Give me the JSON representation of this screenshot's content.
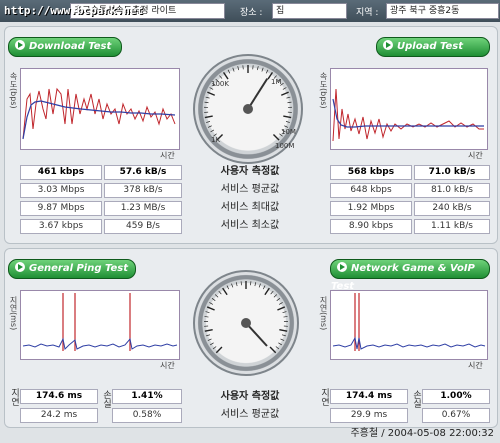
{
  "topbar": {
    "watermark": "http://www.bcpark.net",
    "program_text": "초고속통신속도측정 라이트",
    "place_label": "장소 :",
    "place_value": "집",
    "region_label": "지역 :",
    "region_value": "광주 북구 중흥2동"
  },
  "download": {
    "button": "Download Test",
    "ylabel": "속도(bps)",
    "xlabel": "시간",
    "rows": [
      [
        "461 kbps",
        "57.6 kB/s"
      ],
      [
        "3.03 Mbps",
        "378 kB/s"
      ],
      [
        "9.87 Mbps",
        "1.23 MB/s"
      ],
      [
        "3.67 kbps",
        "459 B/s"
      ]
    ]
  },
  "upload": {
    "button": "Upload Test",
    "ylabel": "속도(bps)",
    "xlabel": "시간",
    "rows": [
      [
        "568 kbps",
        "71.0 kB/s"
      ],
      [
        "648 kbps",
        "81.0 kB/s"
      ],
      [
        "1.92 Mbps",
        "240 kB/s"
      ],
      [
        "8.90 kbps",
        "1.11 kB/s"
      ]
    ]
  },
  "speed_labels": [
    "사용자 측정값",
    "서비스 평균값",
    "서비스 최대값",
    "서비스 최소값"
  ],
  "speed_gauge": {
    "ticks": [
      "100K",
      "1M",
      "10M",
      "100M",
      "1K"
    ],
    "needle_fraction": 0.62
  },
  "ping": {
    "button": "General Ping Test",
    "ylabel": "지연(ms)",
    "xlabel": "시간",
    "side_latency": "지연",
    "side_loss": "손실",
    "rows": [
      [
        "174.6 ms",
        "1.41%"
      ],
      [
        "24.2 ms",
        "0.58%"
      ]
    ]
  },
  "game": {
    "button": "Network Game & VoIP Test",
    "ylabel": "지연(ms)",
    "xlabel": "시간",
    "side_latency": "지연",
    "side_loss": "손실",
    "rows": [
      [
        "174.4 ms",
        "1.00%"
      ],
      [
        "29.9 ms",
        "0.67%"
      ]
    ]
  },
  "ping_labels": [
    "사용자 측정값",
    "서비스 평균값"
  ],
  "footer": "주흥철 / 2004-05-08 22:00:32",
  "colors": {
    "series": "#c0262c",
    "average": "#2f3fa5",
    "button": "#1f8f34"
  }
}
